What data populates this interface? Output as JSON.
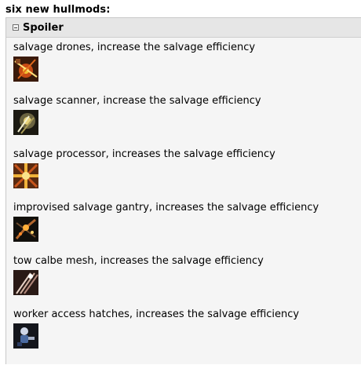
{
  "heading": "six new hullmods:",
  "spoiler": {
    "label": "Spoiler",
    "items": [
      {
        "text": "salvage drones, increase the salvage efficiency",
        "icon": "salvage-drones-icon"
      },
      {
        "text": "salvage scanner, increase the salvage efficiency",
        "icon": "salvage-scanner-icon"
      },
      {
        "text": "salvage processor, increases the salvage efficiency",
        "icon": "salvage-processor-icon"
      },
      {
        "text": "improvised salvage gantry, increases the salvage efficiency",
        "icon": "salvage-gantry-icon"
      },
      {
        "text": "tow calbe mesh, increases the salvage efficiency",
        "icon": "tow-cable-mesh-icon"
      },
      {
        "text": "worker access hatches, increases the salvage efficiency",
        "icon": "worker-access-hatches-icon"
      }
    ]
  }
}
